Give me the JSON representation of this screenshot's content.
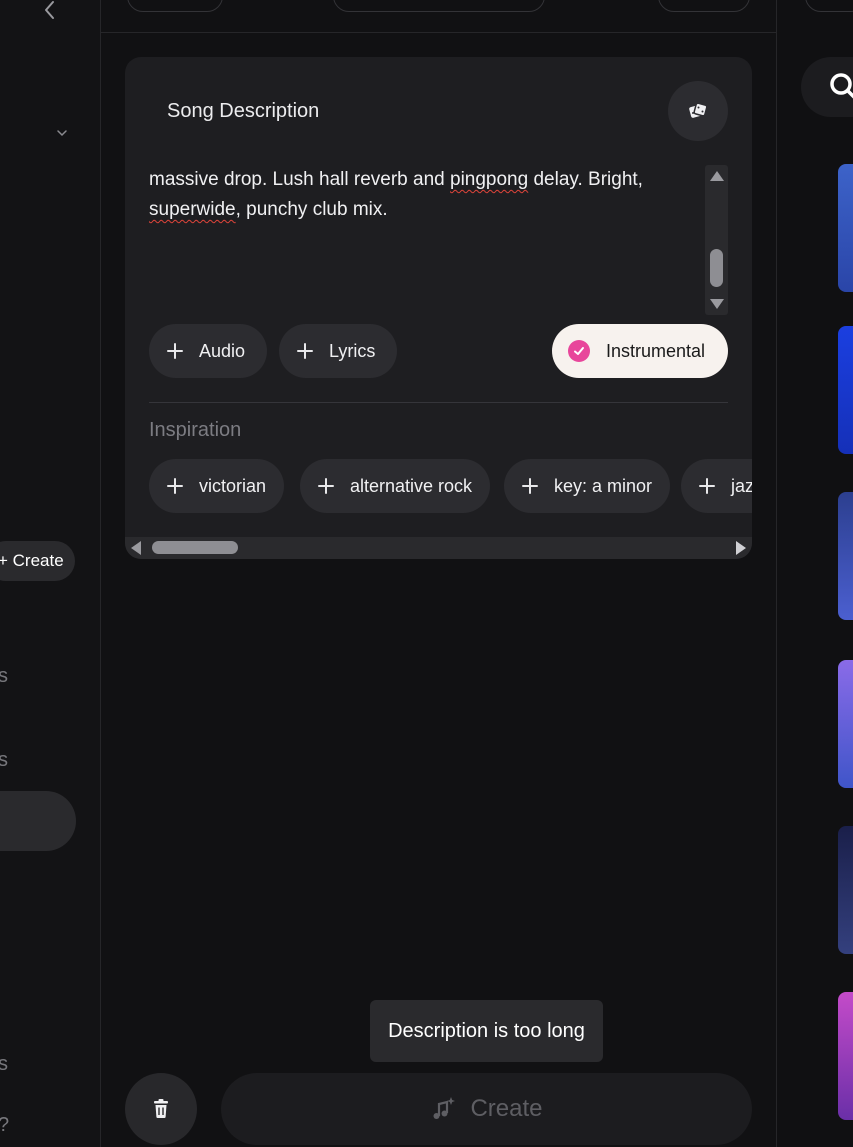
{
  "sidebar": {
    "create_label": "+ Create",
    "partial_labels": [
      "s",
      "s",
      "s",
      "?"
    ]
  },
  "card": {
    "title": "Song Description",
    "description_parts": [
      "massive drop. Lush hall reverb and ",
      "pingpong",
      " delay. Bright,",
      "superwide",
      ", punchy club mix."
    ],
    "chips": {
      "audio": "Audio",
      "lyrics": "Lyrics",
      "instrumental": "Instrumental"
    },
    "inspiration_label": "Inspiration",
    "inspiration_tags": [
      "victorian",
      "alternative rock",
      "key: a minor",
      "jaz"
    ]
  },
  "toast": "Description is too long",
  "create_button": "Create",
  "colors": {
    "accent_pink": "#e8469b",
    "instrumental_bg": "#f7f2ee",
    "background": "#101012",
    "card": "#1e1e21"
  },
  "right_thumbnails": [
    {
      "gradient": "linear-gradient(180deg,#3d63c9,#2a45a8)"
    },
    {
      "gradient": "linear-gradient(180deg,#1b3fe0,#1530b8)"
    },
    {
      "gradient": "linear-gradient(180deg,#2c3f8f,#4b5fd0)"
    },
    {
      "gradient": "linear-gradient(180deg,#8a6be8,#3f55c9)"
    },
    {
      "gradient": "linear-gradient(180deg,#1a1f4a,#34407e)"
    },
    {
      "gradient": "linear-gradient(180deg,#c44bc9,#6a2fa8)"
    }
  ]
}
